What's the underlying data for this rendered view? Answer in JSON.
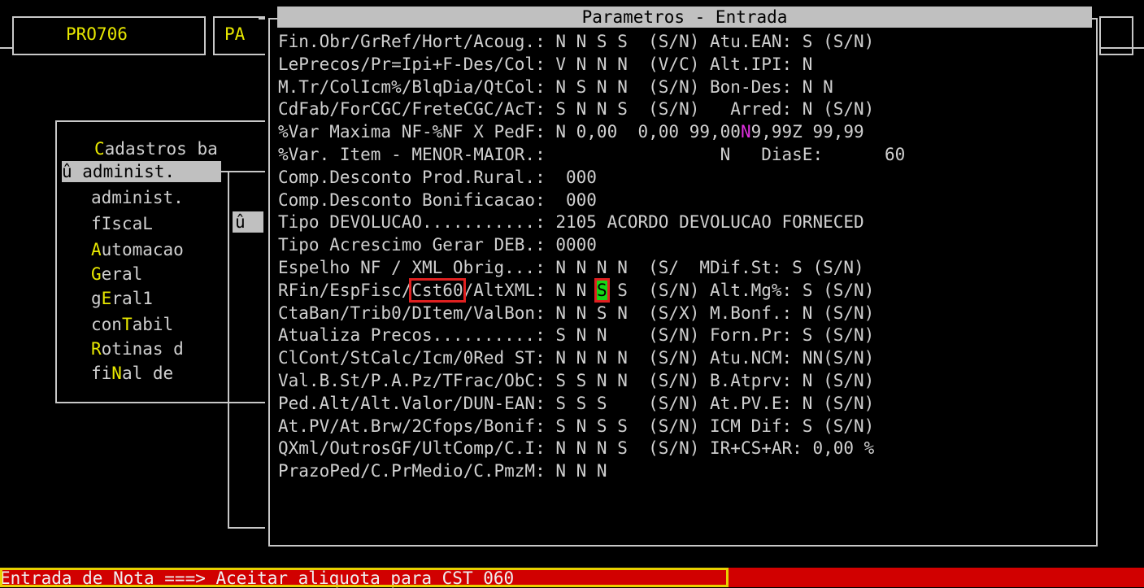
{
  "header": {
    "program_code": "PRO706",
    "second_box": "PA"
  },
  "menu": {
    "title": "Cadastros ba",
    "selected": "û administ.",
    "items": [
      {
        "first": "",
        "rest": "administ."
      },
      {
        "first": "",
        "rest": "fIscaL"
      },
      {
        "first": "A",
        "rest": "utomacao"
      },
      {
        "first": "G",
        "rest": "eral"
      },
      {
        "first": "g",
        "rest": "E"
      },
      {
        "first": "con",
        "rest": "T"
      },
      {
        "first": "R",
        "rest": "otinas d"
      },
      {
        "first": "fi",
        "rest": "N"
      }
    ],
    "item_texts": [
      "administ.",
      "fIscaL",
      "Automacao",
      "Geral",
      "gEral1",
      "conTabil",
      "Rotinas d",
      "fiNal de"
    ],
    "sub_selected": "û"
  },
  "dialog": {
    "title": "Parametros - Entrada",
    "rows": [
      "Fin.Obr/GrRef/Hort/Acoug.: N N S S  (S/N) Atu.EAN: S (S/N)",
      "LePrecos/Pr=Ipi+F-Des/Col: V N N N  (V/C) Alt.IPI: N",
      "M.Tr/ColIcm%/BlqDia/QtCol: N S N N  (S/N) Bon-Des: N N",
      "CdFab/ForCGC/FreteCGC/AcT: S N N S  (S/N)   Arred: N (S/N)",
      "%Var Maxima NF-%NF X PedF: N 0,00  0,00 99,00|N|9,99Z 99,99",
      "%Var. Item - MENOR-MAIOR.:                 N   DiasE:      60",
      "Comp.Desconto Prod.Rural.:  000",
      "Comp.Desconto Bonificacao:  000",
      "Tipo DEVOLUCAO...........: 2105 ACORDO DEVOLUCAO FORNECED",
      "Tipo Acrescimo Gerar DEB.: 0000",
      "Espelho NF / XML Obrig...: N N N N  (S/  MDif.St: S (S/N)",
      "RFin/EspFisc/|Cst60|/AltXML: N N |S| S  (S/N) Alt.Mg%: S (S/N)",
      "CtaBan/Trib0/DItem/ValBon: N N S N  (S/X) M.Bonf.: N (S/N)",
      "Atualiza Precos..........: S N N    (S/N) Forn.Pr: S (S/N)",
      "ClCont/StCalc/Icm/0Red ST: N N N N  (S/N) Atu.NCM: NN(S/N)",
      "Val.B.St/P.A.Pz/TFrac/ObC: S S N N  (S/N) B.Atprv: N (S/N)",
      "Ped.Alt/Alt.Valor/DUN-EAN: S S S    (S/N) At.PV.E: N (S/N)",
      "At.PV/At.Brw/2Cfops/Bonif: S N S S  (S/N) ICM Dif: S (S/N)",
      "QXml/OutrosGF/UltComp/C.I: N N N S  (S/N) IR+CS+AR: 0,00 %",
      "PrazoPed/C.PrMedio/C.PmzM: N N N"
    ],
    "row5_parts": [
      "%Var Maxima NF-%NF X PedF: N 0,00  0,00 99,00",
      "N",
      "9,99Z 99,99"
    ],
    "row11_parts": [
      "RFin/EspFisc/",
      "Cst60",
      "/AltXML: N N ",
      "S",
      " S  (S/N) Alt.Mg%: S (S/N)"
    ]
  },
  "status": {
    "message": "Entrada de Nota ===> Aceitar aliquota para CST 060"
  },
  "colors": {
    "background": "#000000",
    "status_bar": "#d10000",
    "highlight_green": "#16d616",
    "annotation_red": "#e02020",
    "annotation_yellow": "#e8d000"
  }
}
